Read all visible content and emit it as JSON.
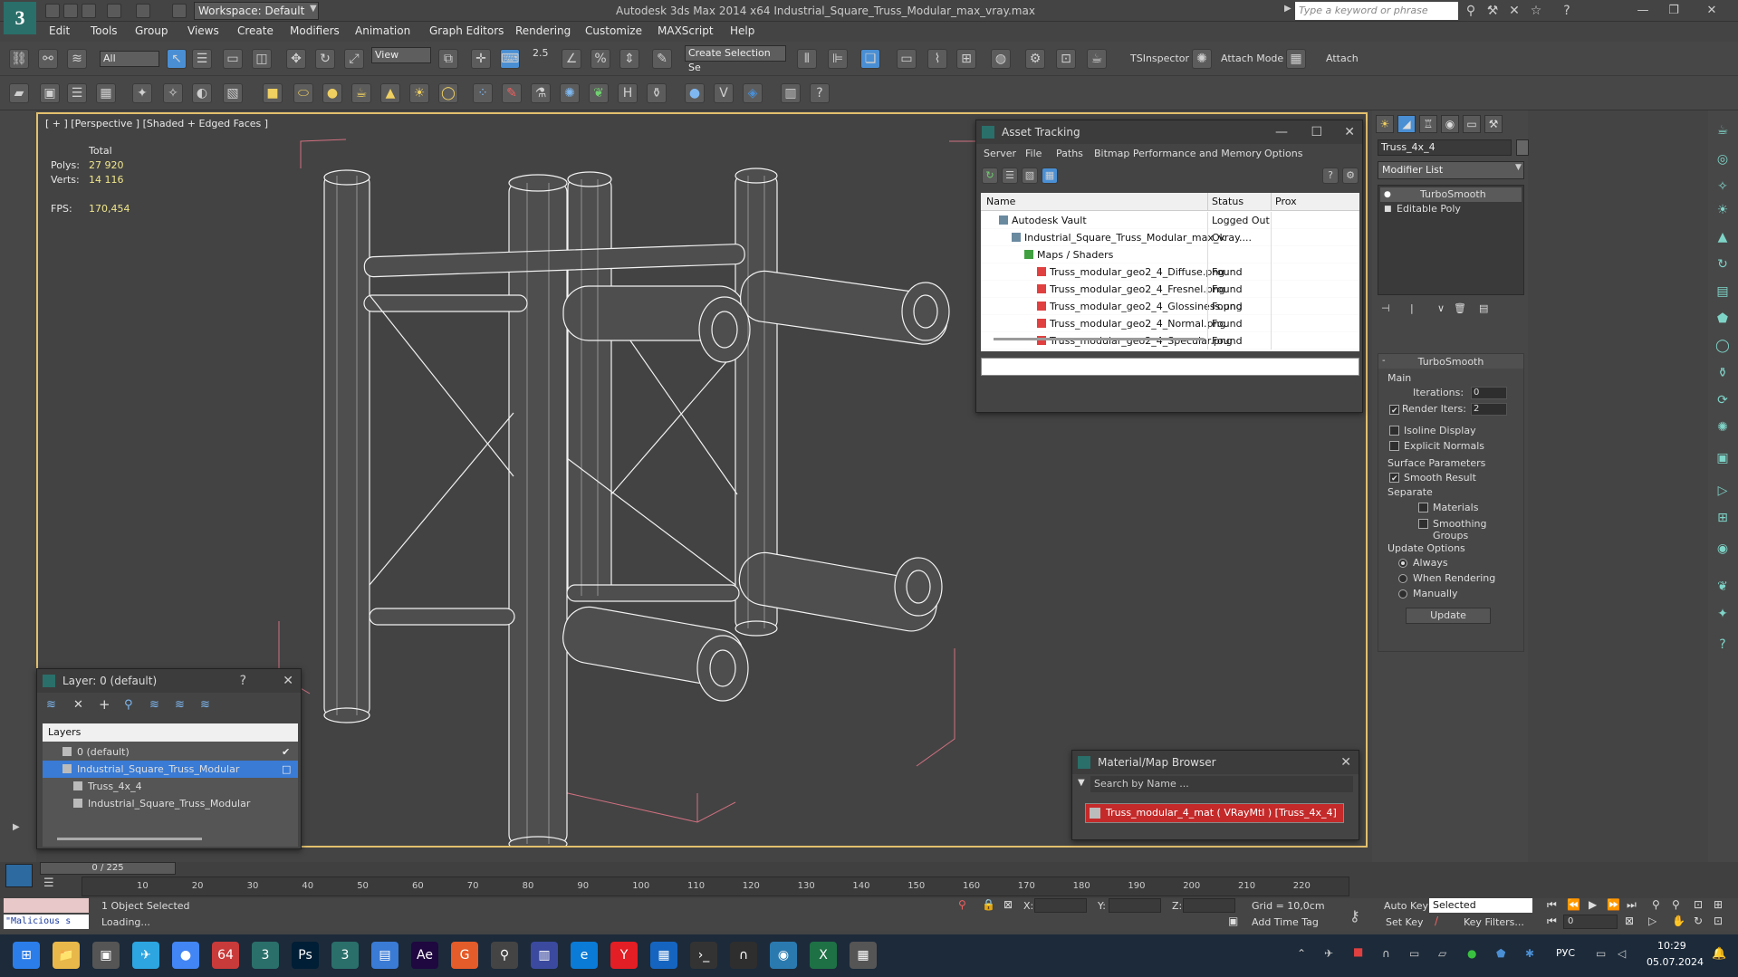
{
  "titlebar": {
    "logo": "3",
    "workspace": "Workspace: Default",
    "app_title": "Autodesk 3ds Max  2014 x64    Industrial_Square_Truss_Modular_max_vray.max",
    "search_placeholder": "Type a keyword or phrase"
  },
  "menu": [
    "Edit",
    "Tools",
    "Group",
    "Views",
    "Create",
    "Modifiers",
    "Animation",
    "Graph Editors",
    "Rendering",
    "Customize",
    "MAXScript",
    "Help"
  ],
  "toolbar": {
    "selection_filter": "All",
    "ref_coord": "View",
    "snap_value": "2.5",
    "selection_set": "Create Selection Se",
    "tsinspector": "TSInspector",
    "attach_mode": "Attach Mode",
    "attach": "Attach"
  },
  "viewport": {
    "label": "[ + ] [Perspective ] [Shaded + Edged Faces ]",
    "total_label": "Total",
    "polys_label": "Polys:",
    "polys_value": "27 920",
    "verts_label": "Verts:",
    "verts_value": "14 116",
    "fps_label": "FPS:",
    "fps_value": "170,454"
  },
  "asset_tracking": {
    "title": "Asset Tracking",
    "menu": [
      "Server",
      "File",
      "Paths",
      "Bitmap Performance and Memory",
      "Options"
    ],
    "columns": [
      "Name",
      "Status",
      "Prox"
    ],
    "rows": [
      {
        "name": "Autodesk Vault",
        "status": "Logged Out ...",
        "indent": 1
      },
      {
        "name": "Industrial_Square_Truss_Modular_max_vray....",
        "status": "Ok",
        "indent": 2
      },
      {
        "name": "Maps / Shaders",
        "status": "",
        "indent": 3
      },
      {
        "name": "Truss_modular_geo2_4_Diffuse.png",
        "status": "Found",
        "indent": 4
      },
      {
        "name": "Truss_modular_geo2_4_Fresnel.png",
        "status": "Found",
        "indent": 4
      },
      {
        "name": "Truss_modular_geo2_4_Glossiness.png",
        "status": "Found",
        "indent": 4
      },
      {
        "name": "Truss_modular_geo2_4_Normal.png",
        "status": "Found",
        "indent": 4
      },
      {
        "name": "Truss_modular_geo2_4_Specular.png",
        "status": "Found",
        "indent": 4
      }
    ]
  },
  "layer": {
    "title": "Layer: 0 (default)",
    "help": "?",
    "header": "Layers",
    "rows": [
      {
        "name": "0 (default)",
        "indent": 1
      },
      {
        "name": "Industrial_Square_Truss_Modular",
        "indent": 1
      },
      {
        "name": "Truss_4x_4",
        "indent": 2
      },
      {
        "name": "Industrial_Square_Truss_Modular",
        "indent": 2
      }
    ]
  },
  "mmb": {
    "title": "Material/Map Browser",
    "search_placeholder": "Search by Name ...",
    "item": "Truss_modular_4_mat  ( VRayMtl )  [Truss_4x_4]"
  },
  "command_panel": {
    "object_name": "Truss_4x_4",
    "modifier_list": "Modifier List",
    "stack": [
      "TurboSmooth",
      "Editable Poly"
    ],
    "rollout_title": "TurboSmooth",
    "main_label": "Main",
    "iterations_label": "Iterations:",
    "iterations_value": "0",
    "render_iters_label": "Render Iters:",
    "render_iters_value": "2",
    "isoline": "Isoline Display",
    "explicit_normals": "Explicit Normals",
    "surface_params": "Surface Parameters",
    "smooth_result": "Smooth Result",
    "separate": "Separate",
    "materials": "Materials",
    "smoothing_groups": "Smoothing Groups",
    "update_options": "Update Options",
    "always": "Always",
    "when_rendering": "When Rendering",
    "manually": "Manually",
    "update_btn": "Update"
  },
  "timeline": {
    "frame": "0 / 225",
    "ticks": [
      "10",
      "20",
      "30",
      "40",
      "50",
      "60",
      "70",
      "80",
      "90",
      "100",
      "110",
      "120",
      "130",
      "140",
      "150",
      "160",
      "170",
      "180",
      "190",
      "200",
      "210",
      "220"
    ]
  },
  "status": {
    "script": "\"Malicious s",
    "selected": "1 Object Selected",
    "loading": "Loading...",
    "x_label": "X:",
    "y_label": "Y:",
    "z_label": "Z:",
    "grid": "Grid = 10,0cm",
    "add_time_tag": "Add Time Tag",
    "auto_key": "Auto Key",
    "set_key": "Set Key",
    "key_mode": "Selected",
    "key_filters": "Key Filters...",
    "frame_value": "0"
  },
  "taskbar": {
    "lang": "РУС",
    "time": "10:29",
    "date": "05.07.2024",
    "icons": [
      "windows-icon",
      "explorer-icon",
      "taskview-icon",
      "telegram-icon",
      "chrome-icon",
      "app64-icon",
      "3dsmax-icon",
      "photoshop-icon",
      "3dsmax2-icon",
      "notepad-icon",
      "aftereffects-icon",
      "guard-icon",
      "search-app-icon",
      "save-icon",
      "edge-icon",
      "yandex-icon",
      "mail-icon",
      "terminal-icon",
      "headphones-icon",
      "camera-icon",
      "excel-icon",
      "calculator-icon"
    ],
    "icon_labels": [
      "⊞",
      "📁",
      "▣",
      "✈",
      "●",
      "64",
      "3",
      "Ps",
      "3",
      "▤",
      "Ae",
      "G",
      "⚲",
      "▥",
      "e",
      "Y",
      "▦",
      "›_",
      "∩",
      "◉",
      "X",
      "▦"
    ],
    "icon_colors": [
      "#2b7de9",
      "#e8b84a",
      "#555",
      "#2ca5e0",
      "#4285f4",
      "#c93a3a",
      "#2a6f6a",
      "#001e36",
      "#2a6f6a",
      "#3a7bd5",
      "#1f0740",
      "#e35c2a",
      "#444",
      "#3b4a9e",
      "#0a7bd6",
      "#e31e24",
      "#1565c0",
      "#333",
      "#2e2e2e",
      "#2a7ab0",
      "#1e7145",
      "#555"
    ]
  }
}
